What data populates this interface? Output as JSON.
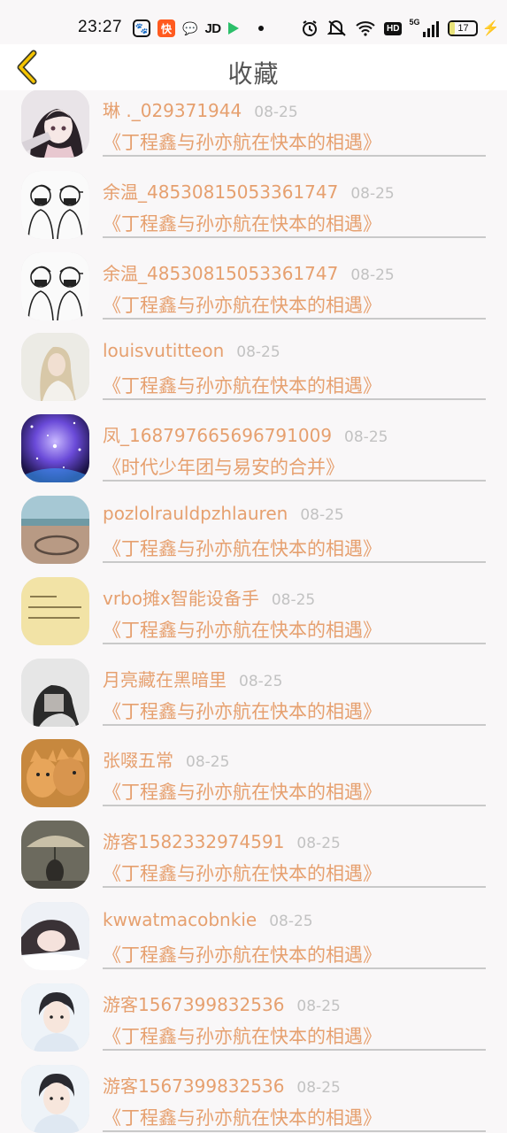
{
  "status_bar": {
    "time": "23:27",
    "left_icons": [
      {
        "name": "baidu-icon",
        "glyph": "🐾"
      },
      {
        "name": "kuaikan-icon",
        "glyph": "快"
      },
      {
        "name": "wechat-icon",
        "glyph": "💬"
      },
      {
        "name": "jd-icon",
        "glyph": "JD"
      }
    ],
    "hd_label": "HD",
    "network_label": "5G",
    "battery_level": "17"
  },
  "header": {
    "back_icon": "chevron-left-icon",
    "title": "收藏",
    "accent_color": "#f5c400"
  },
  "colors": {
    "name": "#e6a06f",
    "date": "#c2c2c2",
    "divider": "#c9c9c9",
    "background": "#f9f7f8"
  },
  "items": [
    {
      "user": "琳 ._029371944",
      "date": "08-25",
      "title": "《丁程鑫与孙亦航在快本的相遇》",
      "avatar": "anime-girl"
    },
    {
      "user": "余温_48530815053361747",
      "date": "08-25",
      "title": "《丁程鑫与孙亦航在快本的相遇》",
      "avatar": "sketch-couple"
    },
    {
      "user": "余温_48530815053361747",
      "date": "08-25",
      "title": "《丁程鑫与孙亦航在快本的相遇》",
      "avatar": "sketch-couple"
    },
    {
      "user": "louisvutitteon",
      "date": "08-25",
      "title": "《丁程鑫与孙亦航在快本的相遇》",
      "avatar": "blonde-woman"
    },
    {
      "user": "凤_168797665696791009",
      "date": "08-25",
      "title": "《时代少年团与易安的合并》",
      "avatar": "galaxy"
    },
    {
      "user": "pozlolrauldpzhlauren",
      "date": "08-25",
      "title": "《丁程鑫与孙亦航在快本的相遇》",
      "avatar": "beach"
    },
    {
      "user": "vrbo摊x智能设备手",
      "date": "08-25",
      "title": "《丁程鑫与孙亦航在快本的相遇》",
      "avatar": "note"
    },
    {
      "user": "月亮藏在黑暗里",
      "date": "08-25",
      "title": "《丁程鑫与孙亦航在快本的相遇》",
      "avatar": "dark-hair"
    },
    {
      "user": "张啜五常",
      "date": "08-25",
      "title": "《丁程鑫与孙亦航在快本的相遇》",
      "avatar": "cats"
    },
    {
      "user": "游客1582332974591",
      "date": "08-25",
      "title": "《丁程鑫与孙亦航在快本的相遇》",
      "avatar": "rain-umbrella"
    },
    {
      "user": "kwwatmacobnkie",
      "date": "08-25",
      "title": "《丁程鑫与孙亦航在快本的相遇》",
      "avatar": "girl-lying"
    },
    {
      "user": "游客1567399832536",
      "date": "08-25",
      "title": "《丁程鑫与孙亦航在快本的相遇》",
      "avatar": "boy-portrait"
    },
    {
      "user": "游客1567399832536",
      "date": "08-25",
      "title": "《丁程鑫与孙亦航在快本的相遇》",
      "avatar": "boy-portrait"
    }
  ]
}
